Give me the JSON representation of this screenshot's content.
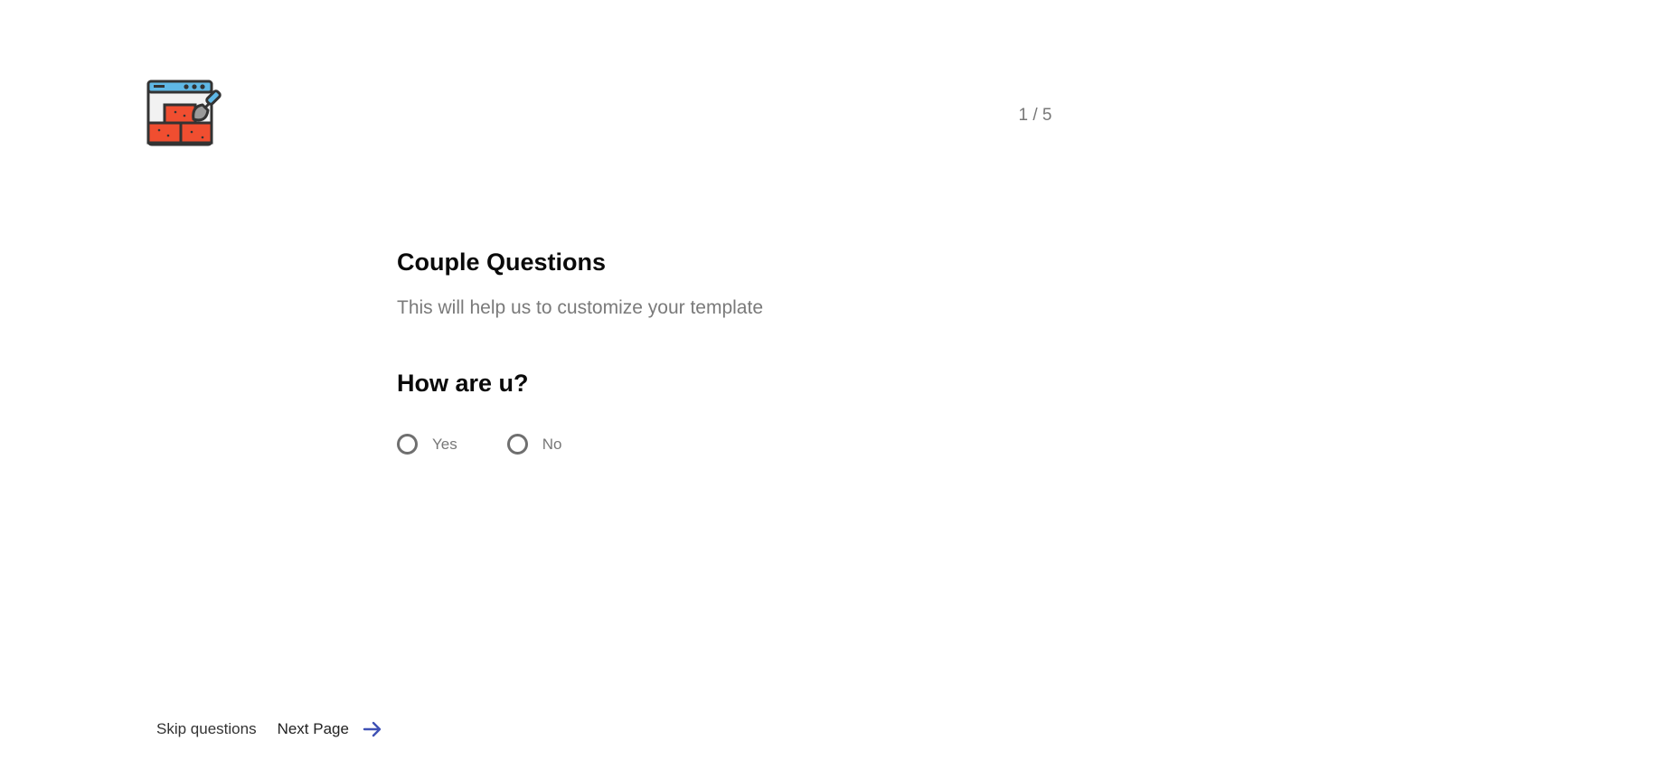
{
  "header": {
    "logo_icon": "brick-wall-trowel-icon",
    "step_counter": "1 / 5"
  },
  "main": {
    "title": "Couple Questions",
    "subtitle": "This will help us to customize your template",
    "question": "How are u?",
    "options": [
      {
        "label": "Yes",
        "selected": false
      },
      {
        "label": "No",
        "selected": false
      }
    ]
  },
  "footer": {
    "skip_label": "Skip questions",
    "next_label": "Next Page",
    "next_icon": "arrow-right-icon",
    "accent_color": "#3f51b5"
  }
}
